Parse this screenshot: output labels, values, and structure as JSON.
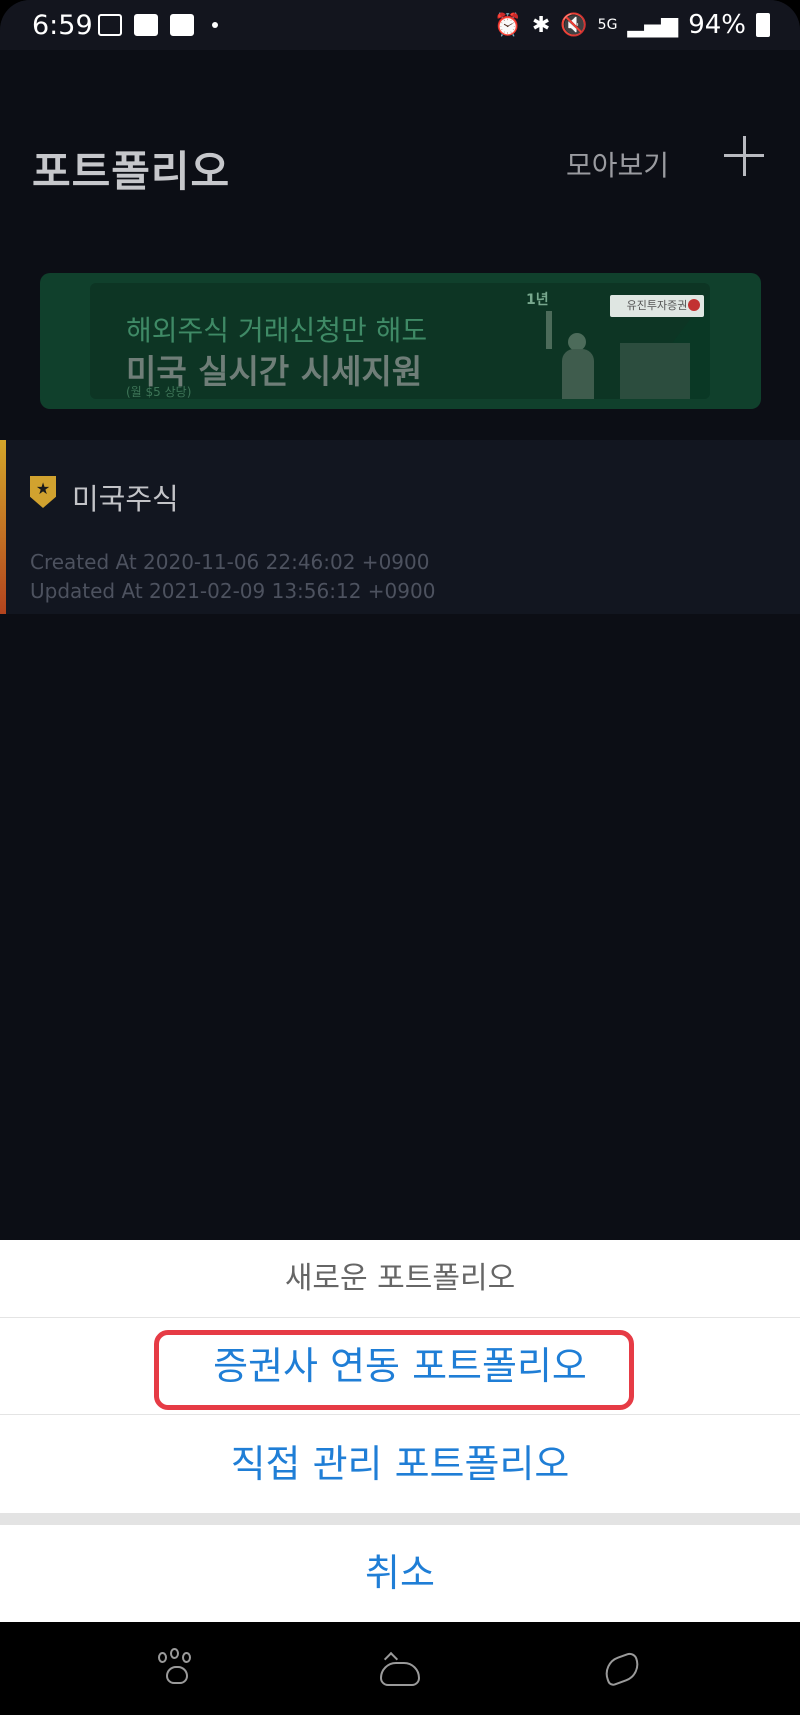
{
  "status_bar": {
    "time": "6:59",
    "battery": "94%",
    "network": "5G"
  },
  "header": {
    "title": "포트폴리오",
    "view_all": "모아보기",
    "add_icon": "plus-icon"
  },
  "banner": {
    "line1": "해외주식 거래신청만 해도",
    "line2": "미국 실시간 시세지원",
    "note": "(월 $5 상당)",
    "badge": "1년",
    "brand": "유진투자증권"
  },
  "portfolio": {
    "name": "미국주식",
    "created": "Created At 2020-11-06 22:46:02 +0900",
    "updated": "Updated At 2021-02-09 13:56:12 +0900"
  },
  "action_sheet": {
    "title": "새로운 포트폴리오",
    "option1": "증권사 연동 포트폴리오",
    "option2": "직접 관리 포트폴리오",
    "cancel": "취소"
  },
  "colors": {
    "accent_blue": "#1f7ed6",
    "highlight_red": "#e63b45",
    "background": "#0c0e15"
  }
}
